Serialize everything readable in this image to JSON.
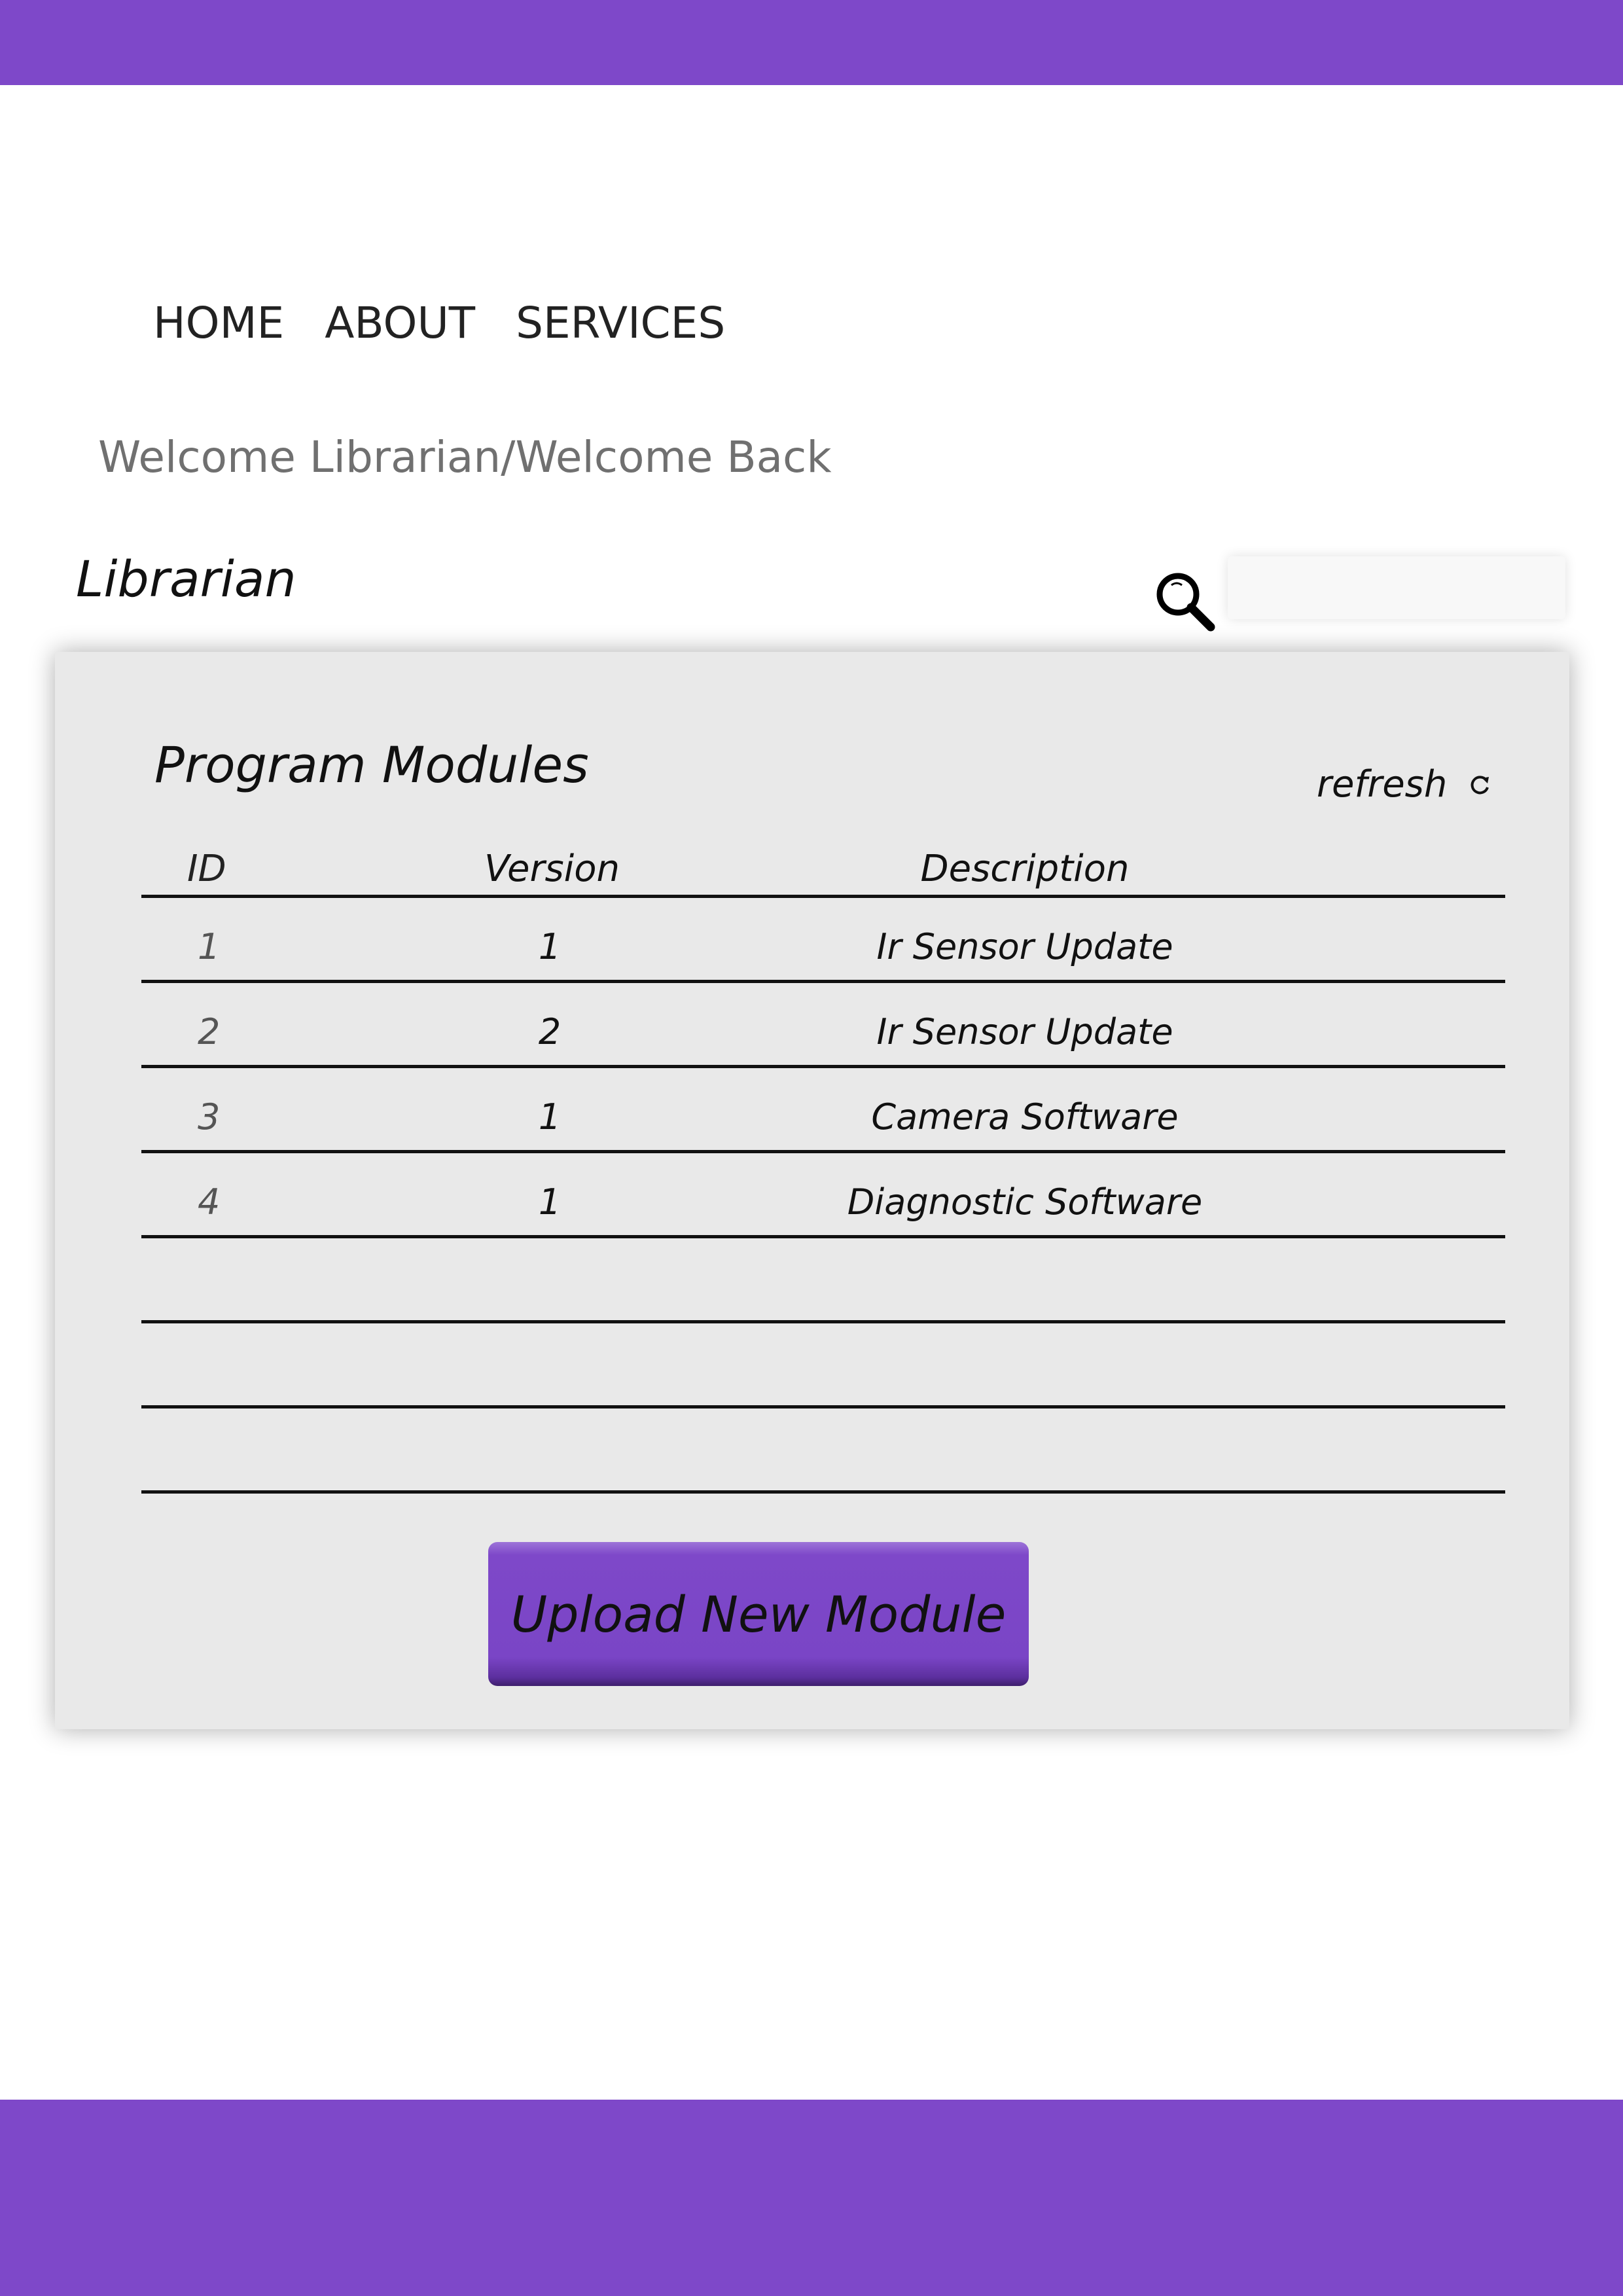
{
  "nav": {
    "items": [
      "HOME",
      "ABOUT",
      "SERVICES"
    ]
  },
  "welcome": {
    "text": "Welcome Librarian/Welcome Back"
  },
  "user": {
    "role": "Librarian"
  },
  "search": {
    "placeholder": "",
    "value": ""
  },
  "panel": {
    "title": "Program Modules",
    "refresh_label": "refresh",
    "columns": [
      "ID",
      "Version",
      "Description"
    ],
    "rows": [
      {
        "id": "1",
        "version": "1",
        "description": "Ir Sensor Update"
      },
      {
        "id": "2",
        "version": "2",
        "description": "Ir Sensor Update"
      },
      {
        "id": "3",
        "version": "1",
        "description": "Camera Software"
      },
      {
        "id": "4",
        "version": "1",
        "description": "Diagnostic Software"
      },
      {
        "id": "",
        "version": "",
        "description": ""
      },
      {
        "id": "",
        "version": "",
        "description": ""
      },
      {
        "id": "",
        "version": "",
        "description": ""
      }
    ],
    "upload_button": "Upload New Module"
  },
  "colors": {
    "accent": "#7e48c9",
    "panel_background": "#e9e9e9"
  },
  "icons": {
    "search": "search-icon",
    "refresh": "refresh-icon"
  }
}
